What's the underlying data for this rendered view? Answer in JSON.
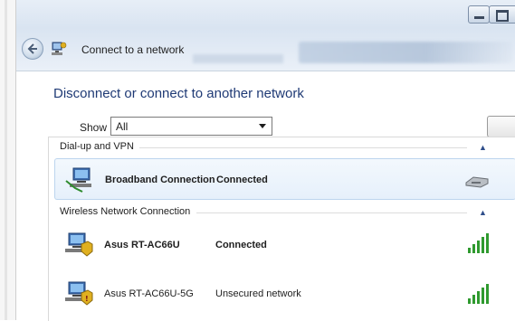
{
  "window": {
    "title": "Connect to a network"
  },
  "main": {
    "heading": "Disconnect or connect to another network",
    "show_label": "Show",
    "show_value": "All"
  },
  "groups": [
    {
      "label": "Dial-up and VPN",
      "connections": [
        {
          "name": "Broadband Connection",
          "status": "Connected",
          "icon": "dialup-connection-icon",
          "indicator": "modem-icon"
        }
      ]
    },
    {
      "label": "Wireless Network Connection",
      "connections": [
        {
          "name": "Asus RT-AC66U",
          "status": "Connected",
          "icon": "wireless-secured-icon",
          "indicator": "signal-strength-icon"
        },
        {
          "name": "Asus RT-AC66U-5G",
          "status": "Unsecured network",
          "icon": "wireless-unsecured-icon",
          "indicator": "signal-strength-icon"
        }
      ]
    }
  ],
  "colors": {
    "heading": "#1f3a75",
    "signal_green": "#2f9a2f",
    "selection": "#e6f0fb"
  }
}
